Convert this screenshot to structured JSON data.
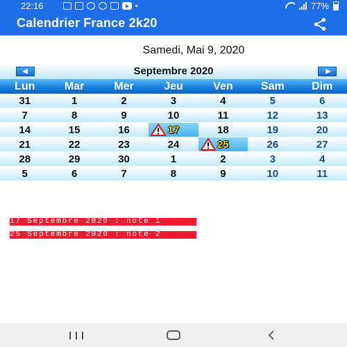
{
  "status_bar": {
    "time": "22:16",
    "battery": "77%"
  },
  "app_bar": {
    "title": "Calendrier France 2k20",
    "share_icon": "share-icon"
  },
  "current_date": "Samedi, Mai 9, 2020",
  "calendar": {
    "month_label": "Septembre  2020",
    "weekdays": [
      "Lun",
      "Mar",
      "Mer",
      "Jeu",
      "Ven",
      "Sam",
      "Dim"
    ],
    "weeks": [
      [
        "31",
        "1",
        "2",
        "3",
        "4",
        "5",
        "6"
      ],
      [
        "7",
        "8",
        "9",
        "10",
        "11",
        "12",
        "13"
      ],
      [
        "14",
        "15",
        "16",
        "17",
        "18",
        "19",
        "20"
      ],
      [
        "21",
        "22",
        "23",
        "24",
        "25",
        "26",
        "27"
      ],
      [
        "28",
        "29",
        "30",
        "1",
        "2",
        "3",
        "4"
      ],
      [
        "5",
        "6",
        "7",
        "8",
        "9",
        "10",
        "11"
      ]
    ],
    "marked_days": [
      "17",
      "25"
    ],
    "colors": {
      "header_blue": "#1b7fdf",
      "weekend_text": "#1a4c8a",
      "marked_bg": "#4ab3ef",
      "marked_text": "#f7d21b"
    }
  },
  "notes": [
    "17 Septembre 2020 : note 1",
    "25 Septembre 2020 : note 2"
  ],
  "colors": {
    "app_bar": "#1f6fec",
    "note_bg": "#ed1c31"
  }
}
